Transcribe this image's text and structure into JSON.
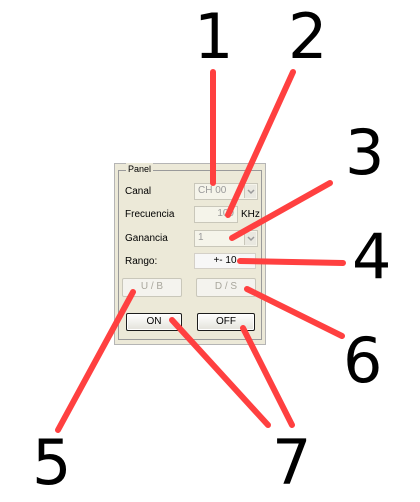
{
  "panel": {
    "title": "Panel",
    "canal": {
      "label": "Canal",
      "value": "CH 00"
    },
    "frecuencia": {
      "label": "Frecuencia",
      "value": "100",
      "unit": "KHz"
    },
    "ganancia": {
      "label": "Ganancia",
      "value": "1"
    },
    "rango": {
      "label": "Rango:",
      "value": "+- 10"
    },
    "buttons": {
      "ub": "U / B",
      "ds": "D / S",
      "on": "ON",
      "off": "OFF"
    }
  },
  "callouts": [
    "1",
    "2",
    "3",
    "4",
    "5",
    "6",
    "7"
  ],
  "colors": {
    "callout_line": "#ff4040",
    "panel_bg": "#ece9d8"
  }
}
